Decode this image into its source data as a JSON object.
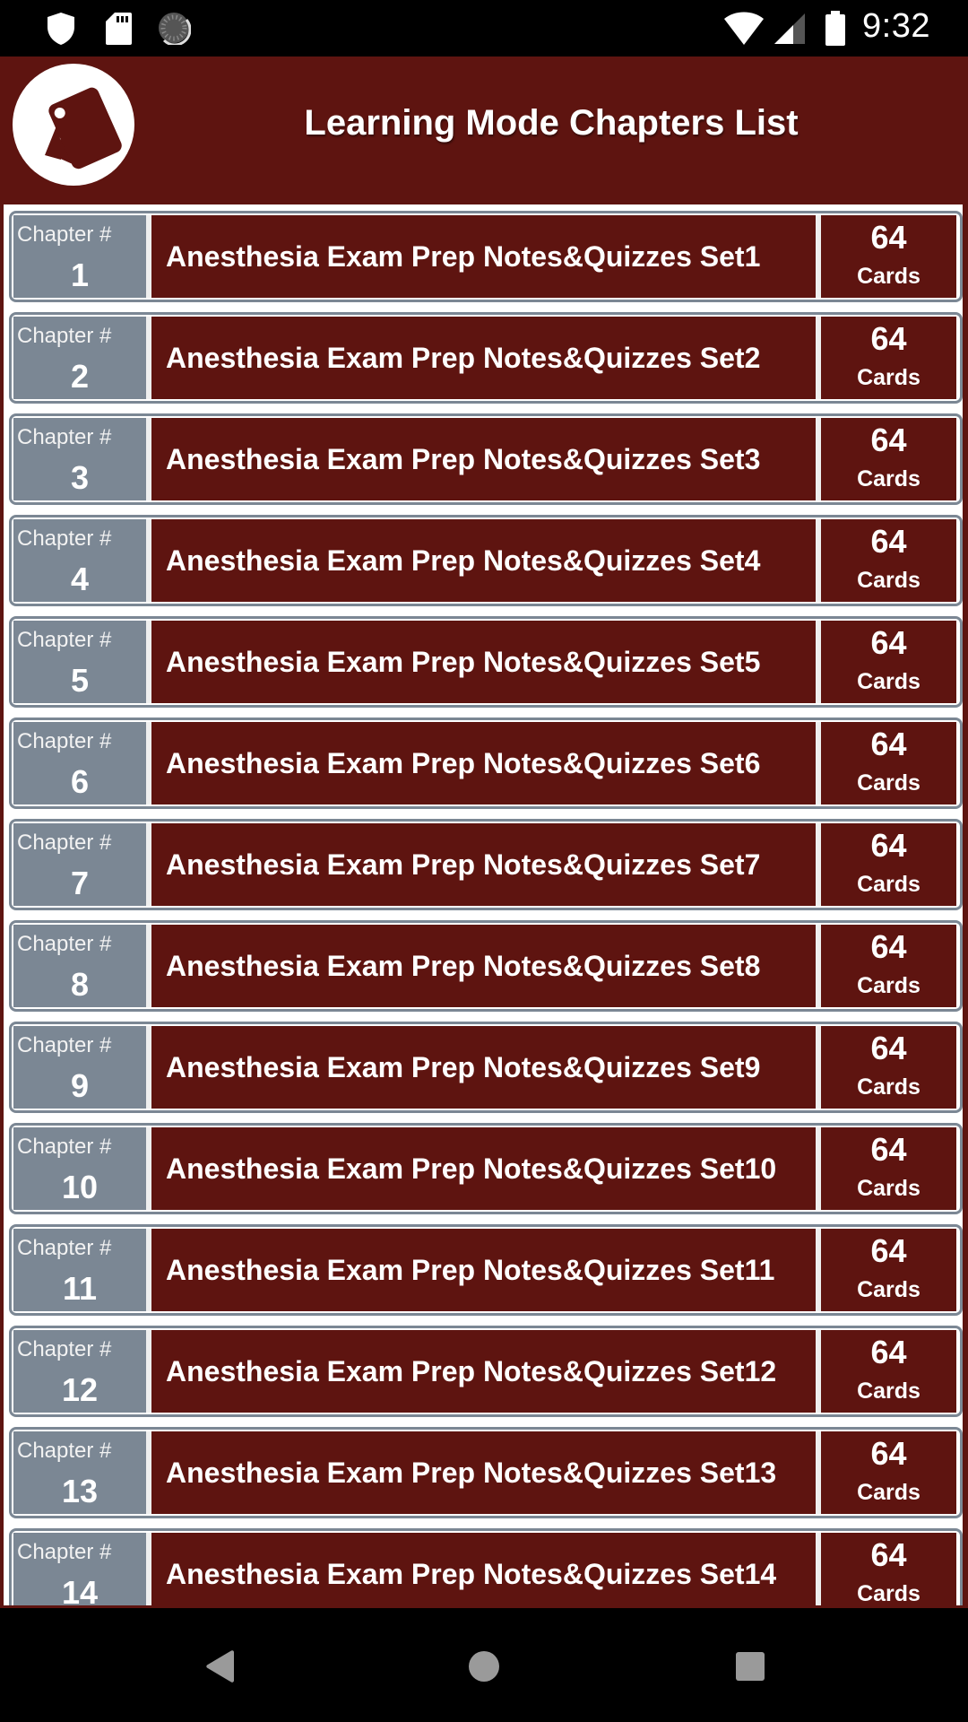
{
  "status_bar": {
    "time": "9:32",
    "left_icons": [
      "shield-icon",
      "sd-card-icon",
      "loading-icon"
    ],
    "right_icons": [
      "wifi-icon",
      "cell-signal-icon",
      "battery-icon"
    ]
  },
  "header": {
    "logo": "flashcards-logo",
    "title": "Learning Mode Chapters List"
  },
  "colors": {
    "primary": "#5e1410",
    "chapter_cell": "#7b8794",
    "text": "#ffffff"
  },
  "chapters": [
    {
      "label": "Chapter #",
      "number": "1",
      "title": "Anesthesia Exam Prep Notes&Quizzes Set1",
      "count": "64",
      "unit": "Cards"
    },
    {
      "label": "Chapter #",
      "number": "2",
      "title": "Anesthesia Exam Prep Notes&Quizzes Set2",
      "count": "64",
      "unit": "Cards"
    },
    {
      "label": "Chapter #",
      "number": "3",
      "title": "Anesthesia Exam Prep Notes&Quizzes Set3",
      "count": "64",
      "unit": "Cards"
    },
    {
      "label": "Chapter #",
      "number": "4",
      "title": "Anesthesia Exam Prep Notes&Quizzes Set4",
      "count": "64",
      "unit": "Cards"
    },
    {
      "label": "Chapter #",
      "number": "5",
      "title": "Anesthesia Exam Prep Notes&Quizzes Set5",
      "count": "64",
      "unit": "Cards"
    },
    {
      "label": "Chapter #",
      "number": "6",
      "title": "Anesthesia Exam Prep Notes&Quizzes Set6",
      "count": "64",
      "unit": "Cards"
    },
    {
      "label": "Chapter #",
      "number": "7",
      "title": "Anesthesia Exam Prep Notes&Quizzes Set7",
      "count": "64",
      "unit": "Cards"
    },
    {
      "label": "Chapter #",
      "number": "8",
      "title": "Anesthesia Exam Prep Notes&Quizzes Set8",
      "count": "64",
      "unit": "Cards"
    },
    {
      "label": "Chapter #",
      "number": "9",
      "title": "Anesthesia Exam Prep Notes&Quizzes Set9",
      "count": "64",
      "unit": "Cards"
    },
    {
      "label": "Chapter #",
      "number": "10",
      "title": "Anesthesia Exam Prep Notes&Quizzes Set10",
      "count": "64",
      "unit": "Cards"
    },
    {
      "label": "Chapter #",
      "number": "11",
      "title": "Anesthesia Exam Prep Notes&Quizzes Set11",
      "count": "64",
      "unit": "Cards"
    },
    {
      "label": "Chapter #",
      "number": "12",
      "title": "Anesthesia Exam Prep Notes&Quizzes Set12",
      "count": "64",
      "unit": "Cards"
    },
    {
      "label": "Chapter #",
      "number": "13",
      "title": "Anesthesia Exam Prep Notes&Quizzes Set13",
      "count": "64",
      "unit": "Cards"
    },
    {
      "label": "Chapter #",
      "number": "14",
      "title": "Anesthesia Exam Prep Notes&Quizzes Set14",
      "count": "64",
      "unit": "Cards"
    }
  ],
  "nav_bar": {
    "buttons": [
      "back-icon",
      "home-icon",
      "recents-icon"
    ]
  }
}
